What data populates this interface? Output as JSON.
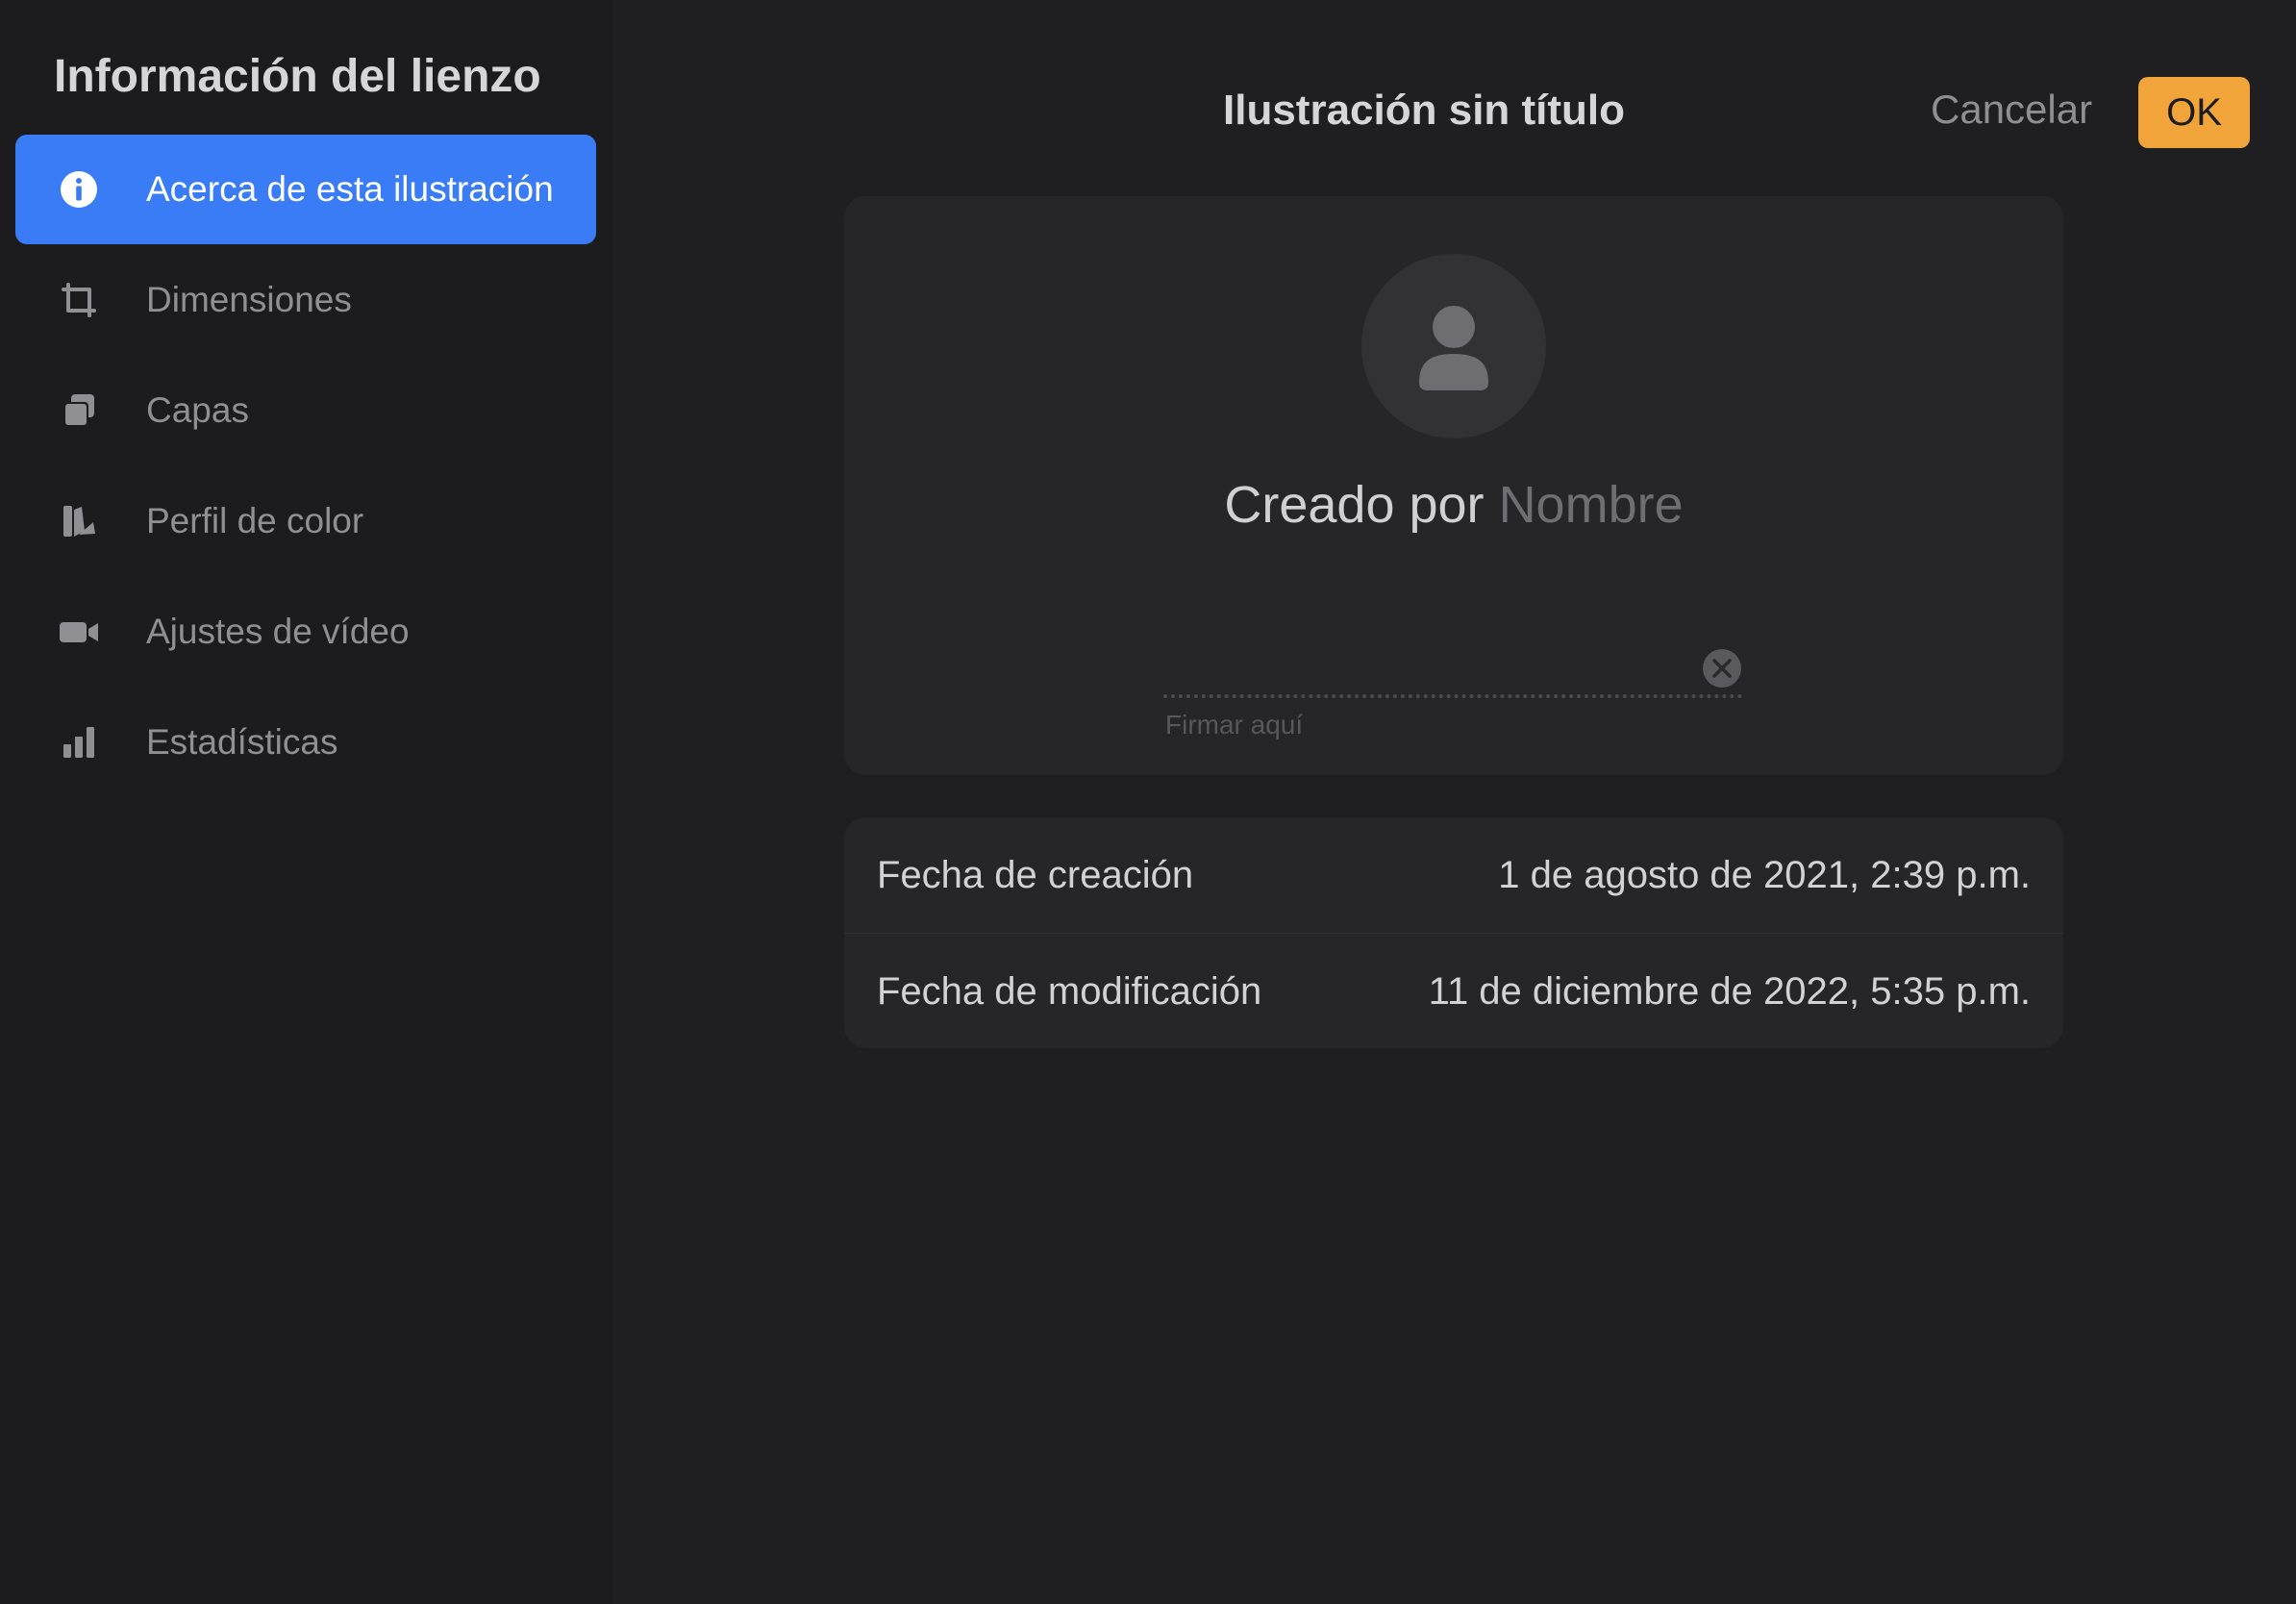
{
  "sidebar": {
    "title": "Información del lienzo",
    "items": [
      {
        "label": "Acerca de esta ilustración",
        "icon": "info-icon",
        "active": true
      },
      {
        "label": "Dimensiones",
        "icon": "crop-icon",
        "active": false
      },
      {
        "label": "Capas",
        "icon": "layers-icon",
        "active": false
      },
      {
        "label": "Perfil de color",
        "icon": "color-swatch-icon",
        "active": false
      },
      {
        "label": "Ajustes de vídeo",
        "icon": "video-camera-icon",
        "active": false
      },
      {
        "label": "Estadísticas",
        "icon": "bar-chart-icon",
        "active": false
      }
    ]
  },
  "header": {
    "title": "Ilustración sin título",
    "cancel_label": "Cancelar",
    "ok_label": "OK"
  },
  "author": {
    "created_by_prefix": "Creado por",
    "name_placeholder": "Nombre",
    "signature_hint": "Firmar aquí"
  },
  "dates": [
    {
      "label": "Fecha de creación",
      "value": "1 de agosto de 2021, 2:39 p.m."
    },
    {
      "label": "Fecha de modificación",
      "value": "11 de diciembre de 2022, 5:35 p.m."
    }
  ],
  "colors": {
    "accent_blue": "#3a7cf5",
    "ok_orange": "#f0a43a",
    "background": "#1f1f21",
    "sidebar_background": "#1c1c1e",
    "card_background": "#262628"
  }
}
